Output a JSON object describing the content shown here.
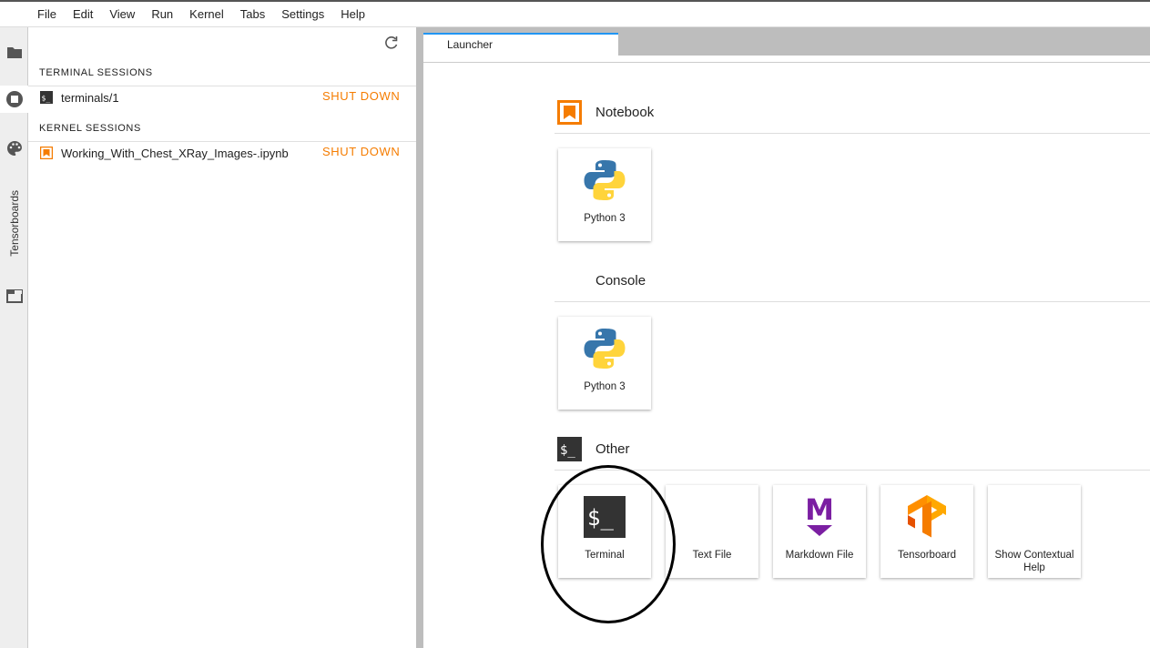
{
  "menu": [
    "File",
    "Edit",
    "View",
    "Run",
    "Kernel",
    "Tabs",
    "Settings",
    "Help"
  ],
  "activity_bar": {
    "items": [
      {
        "name": "folder-icon"
      },
      {
        "name": "running-sessions-icon"
      },
      {
        "name": "palette-icon"
      },
      {
        "name": "tab-list-icon"
      }
    ],
    "vertical_label": "Tensorboards"
  },
  "sessions_panel": {
    "terminal_header": "TERMINAL SESSIONS",
    "terminal_sessions": [
      {
        "label": "terminals/1",
        "action": "SHUT DOWN",
        "icon": "terminal-icon"
      }
    ],
    "kernel_header": "KERNEL SESSIONS",
    "kernel_sessions": [
      {
        "label": "Working_With_Chest_XRay_Images-.ipynb",
        "action": "SHUT DOWN",
        "icon": "notebook-icon"
      }
    ]
  },
  "tabs": [
    {
      "label": "Launcher",
      "active": true
    }
  ],
  "launcher": {
    "categories": [
      {
        "title": "Notebook",
        "icon": "notebook-icon",
        "cards": [
          {
            "label": "Python 3",
            "icon": "python-logo"
          }
        ]
      },
      {
        "title": "Console",
        "icon": "",
        "cards": [
          {
            "label": "Python 3",
            "icon": "python-logo"
          }
        ]
      },
      {
        "title": "Other",
        "icon": "terminal-icon",
        "cards": [
          {
            "label": "Terminal",
            "icon": "terminal-icon"
          },
          {
            "label": "Text File",
            "icon": ""
          },
          {
            "label": "Markdown File",
            "icon": "markdown-icon"
          },
          {
            "label": "Tensorboard",
            "icon": "tensorflow-logo"
          },
          {
            "label": "Show Contextual Help",
            "icon": ""
          }
        ]
      }
    ]
  },
  "colors": {
    "accent_orange": "#f57c00",
    "tab_active_border": "#2196f3",
    "markdown_purple": "#7b1fa2",
    "annotation_circle": "#000000"
  }
}
